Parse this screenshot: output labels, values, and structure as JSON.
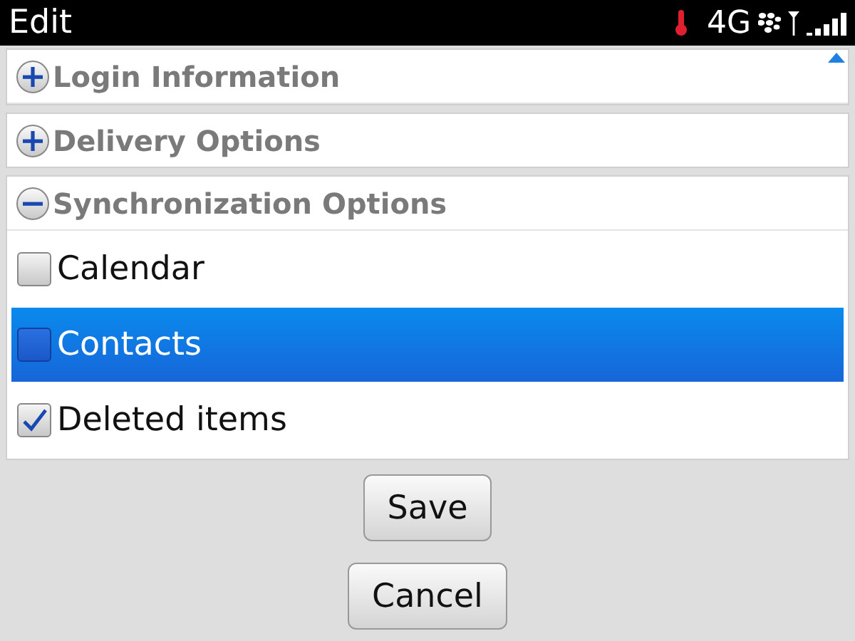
{
  "window": {
    "title": "Edit",
    "network": "4G"
  },
  "sections": [
    {
      "title": "Login Information",
      "expanded": false
    },
    {
      "title": "Delivery Options",
      "expanded": false
    },
    {
      "title": "Synchronization Options",
      "expanded": true,
      "items": [
        {
          "label": "Calendar",
          "checked": false,
          "selected": false
        },
        {
          "label": "Contacts",
          "checked": false,
          "selected": true
        },
        {
          "label": "Deleted items",
          "checked": true,
          "selected": false
        }
      ]
    }
  ],
  "buttons": [
    {
      "label": "Save"
    },
    {
      "label": "Cancel"
    }
  ]
}
